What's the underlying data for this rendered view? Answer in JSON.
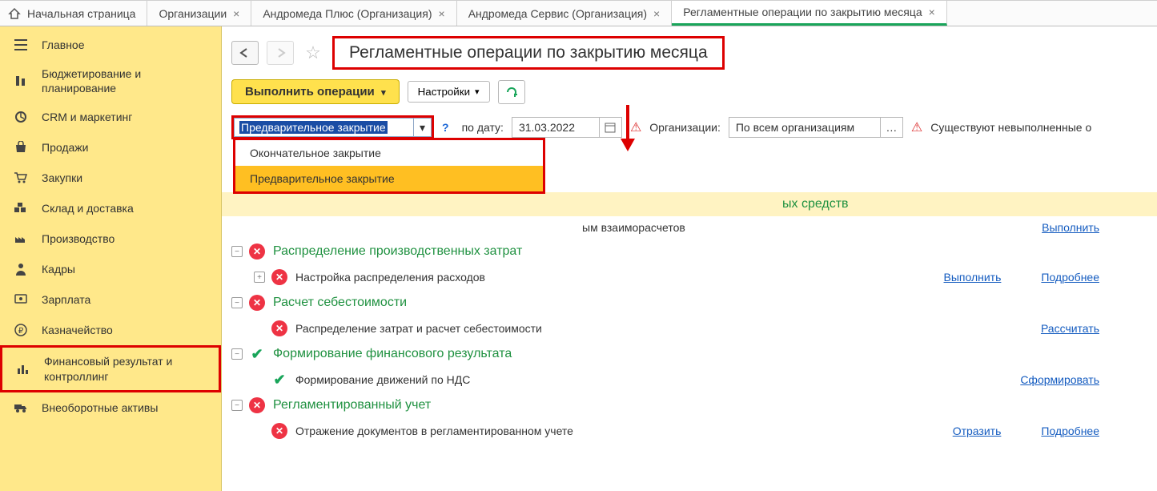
{
  "tabs": {
    "home": "Начальная страница",
    "t1": "Организации",
    "t2": "Андромеда Плюс (Организация)",
    "t3": "Андромеда Сервис (Организация)",
    "t4": "Регламентные операции по закрытию месяца"
  },
  "sidebar": {
    "main": "Главное",
    "budget": "Бюджетирование и планирование",
    "crm": "CRM и маркетинг",
    "sales": "Продажи",
    "purchase": "Закупки",
    "warehouse": "Склад и доставка",
    "production": "Производство",
    "hr": "Кадры",
    "salary": "Зарплата",
    "treasury": "Казначейство",
    "finresult": "Финансовый результат и контроллинг",
    "assets": "Внеоборотные активы"
  },
  "page": {
    "title": "Регламентные операции по закрытию месяца",
    "run_btn": "Выполнить операции",
    "settings_btn": "Настройки",
    "mode_value": "Предварительное закрытие",
    "date_label": "по дату:",
    "date_value": "31.03.2022",
    "org_label": "Организации:",
    "org_value": "По всем организациям",
    "warn_text": "Существуют невыполненные о"
  },
  "dropdown": {
    "opt1": "Окончательное закрытие",
    "opt2": "Предварительное закрытие"
  },
  "tree": {
    "g0_suffix": "ых средств",
    "g0_r1": "ым взаиморасчетов",
    "g1": "Распределение производственных затрат",
    "g1_r1": "Настройка распределения расходов",
    "g2": "Расчет себестоимости",
    "g2_r1": "Распределение затрат и расчет себестоимости",
    "g3": "Формирование финансового результата",
    "g3_r1": "Формирование движений по НДС",
    "g4": "Регламентированный учет",
    "g4_r1": "Отражение документов в регламентированном учете",
    "link_run": "Выполнить",
    "link_more": "Подробнее",
    "link_calc": "Рассчитать",
    "link_form": "Сформировать",
    "link_refl": "Отразить"
  }
}
